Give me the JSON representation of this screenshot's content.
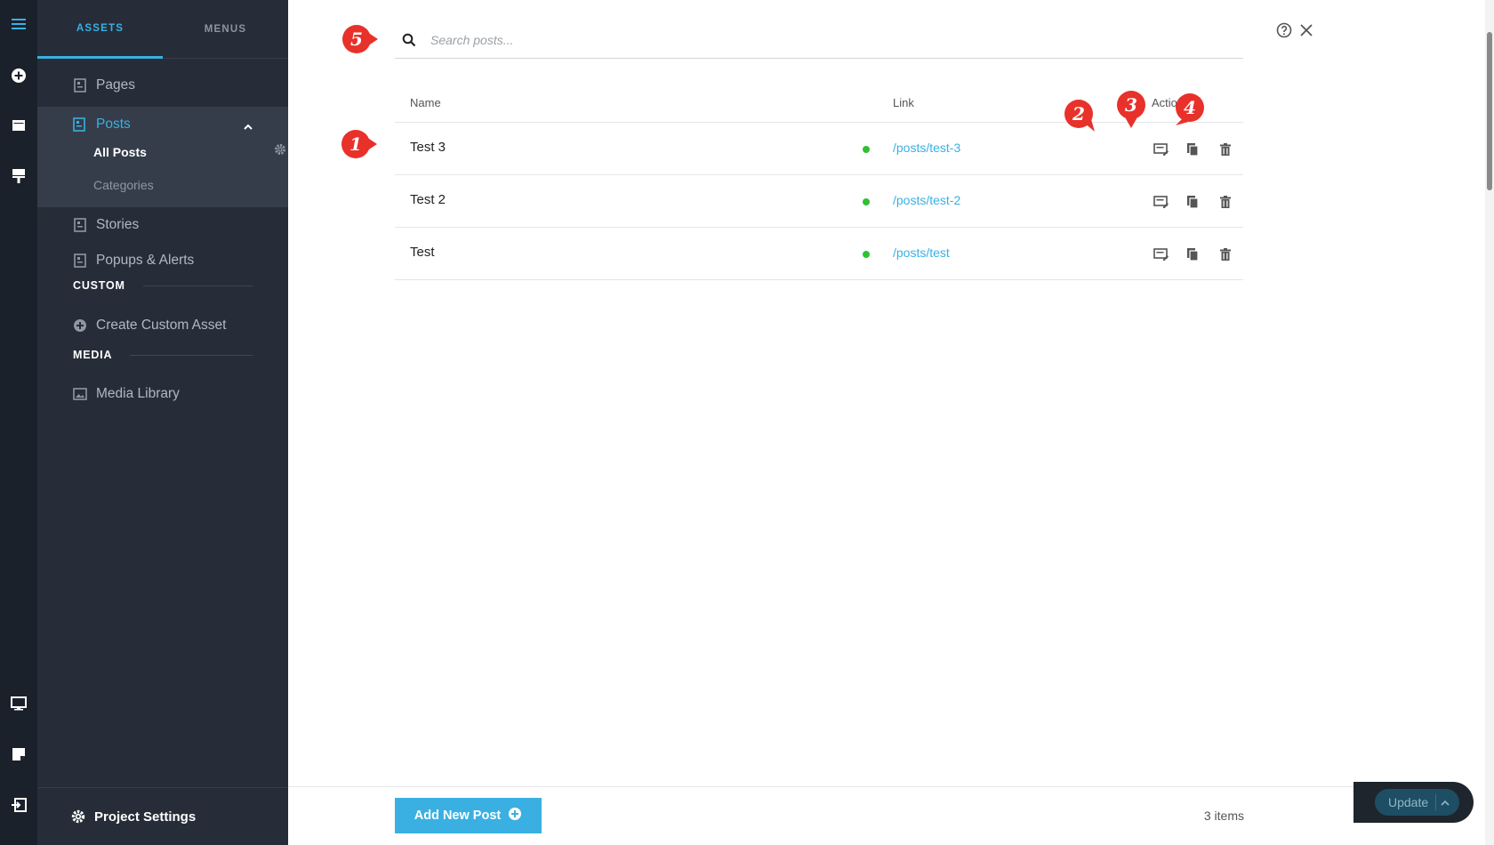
{
  "tabs": {
    "assets": "ASSETS",
    "menus": "MENUS"
  },
  "nav": {
    "pages": "Pages",
    "posts": "Posts",
    "all_posts": "All Posts",
    "categories": "Categories",
    "stories": "Stories",
    "popups": "Popups & Alerts",
    "custom_section": "CUSTOM",
    "create_custom": "Create Custom Asset",
    "media_section": "MEDIA",
    "media_library": "Media Library",
    "project_settings": "Project Settings"
  },
  "search": {
    "placeholder": "Search posts..."
  },
  "table": {
    "headers": {
      "name": "Name",
      "link": "Link",
      "actions": "Actions"
    },
    "rows": [
      {
        "name": "Test 3",
        "link": "/posts/test-3",
        "status_color": "#2fc22f"
      },
      {
        "name": "Test 2",
        "link": "/posts/test-2",
        "status_color": "#2fc22f"
      },
      {
        "name": "Test",
        "link": "/posts/test",
        "status_color": "#2fc22f"
      }
    ]
  },
  "footer": {
    "add_button": "Add New Post",
    "items_count": "3 items"
  },
  "update": {
    "label": "Update"
  },
  "annotations": {
    "m1": "1",
    "m2": "2",
    "m3": "3",
    "m4": "4",
    "m5": "5"
  },
  "colors": {
    "accent": "#3ab0e2",
    "annotation": "#e8312a",
    "sidebar": "#262d38",
    "rail": "#1b212b"
  },
  "icons": [
    "menu-icon",
    "add-circle-icon",
    "window-icon",
    "brush-icon",
    "page-icon",
    "gear-icon",
    "plus-circle-icon",
    "image-icon",
    "search-icon",
    "help-icon",
    "close-icon",
    "edit-icon",
    "duplicate-icon",
    "trash-icon",
    "desktop-icon",
    "note-icon",
    "exit-icon",
    "chevron-up-icon"
  ]
}
